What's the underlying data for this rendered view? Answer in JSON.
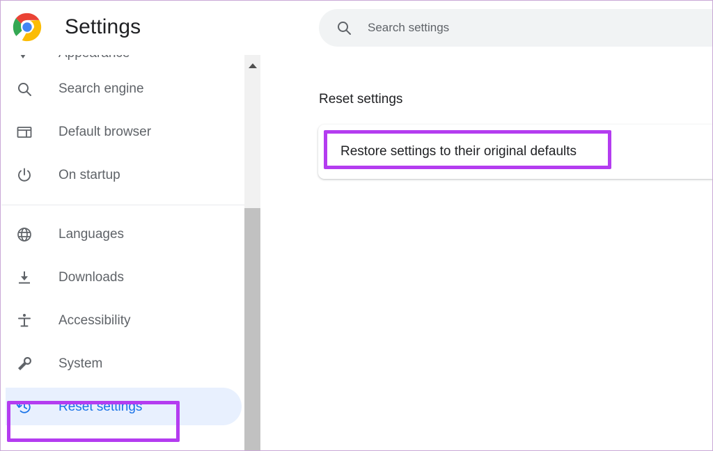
{
  "window": {
    "border_color": "#c9a8d6"
  },
  "header": {
    "logo_name": "chrome-logo",
    "title": "Settings"
  },
  "search": {
    "icon": "search-icon",
    "placeholder": "Search settings",
    "value": ""
  },
  "sidebar": {
    "items": [
      {
        "label": "Appearance",
        "icon": "paint-roller-icon",
        "selected": false,
        "clipped": true
      },
      {
        "label": "Search engine",
        "icon": "search-icon",
        "selected": false
      },
      {
        "label": "Default browser",
        "icon": "browser-window-icon",
        "selected": false
      },
      {
        "label": "On startup",
        "icon": "power-icon",
        "selected": false
      },
      {
        "label": "Languages",
        "icon": "globe-icon",
        "selected": false
      },
      {
        "label": "Downloads",
        "icon": "download-icon",
        "selected": false
      },
      {
        "label": "Accessibility",
        "icon": "accessibility-icon",
        "selected": false
      },
      {
        "label": "System",
        "icon": "wrench-icon",
        "selected": false
      },
      {
        "label": "Reset settings",
        "icon": "history-restore-icon",
        "selected": true
      }
    ],
    "selected_item": "Reset settings",
    "selected_color": "#1a73e8",
    "selected_pill_color": "#e8f0fe",
    "text_color": "#5f6368"
  },
  "scrollbar": {
    "up_arrow_icon": "caret-up-icon",
    "thumb_color": "#c1c1c1",
    "track_color": "#f1f1f1"
  },
  "main": {
    "section_title": "Reset settings",
    "card_rows": [
      {
        "label": "Restore settings to their original defaults",
        "annotated": true
      }
    ]
  },
  "annotations": {
    "color": "#b43cf0",
    "targets": [
      "Reset settings",
      "Restore settings to their original defaults"
    ]
  }
}
